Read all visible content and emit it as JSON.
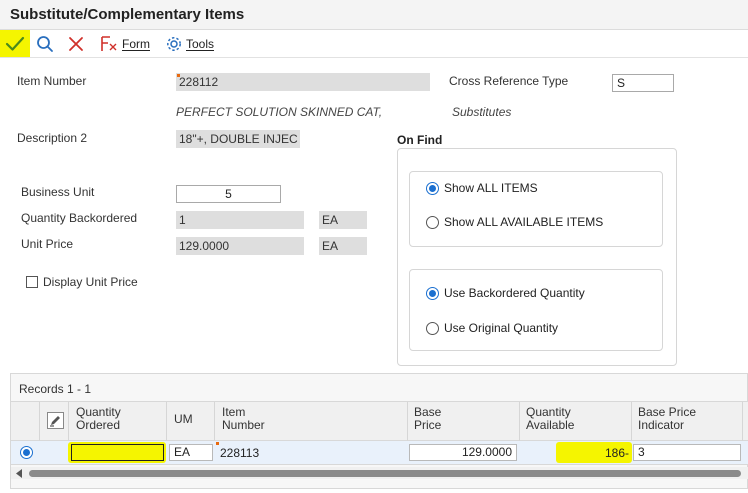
{
  "window": {
    "title": "Substitute/Complementary Items"
  },
  "toolbar": {
    "ok_icon": "checkmark-icon",
    "find_icon": "search-icon",
    "cancel_icon": "close-icon",
    "form_label": "Form",
    "tools_label": "Tools",
    "highlight_color": "#f5f500"
  },
  "header": {
    "item_number_label": "Item Number",
    "item_number_value": "228112",
    "item_description": "PERFECT SOLUTION SKINNED CAT,",
    "cross_ref_type_label": "Cross Reference Type",
    "cross_ref_type_value": "S",
    "cross_ref_type_desc": "Substitutes",
    "description2_label": "Description 2",
    "description2_value": "18\"+, DOUBLE INJEC",
    "business_unit_label": "Business Unit",
    "business_unit_value": "5",
    "qty_backordered_label": "Quantity Backordered",
    "qty_backordered_value": "1",
    "qty_backordered_um": "EA",
    "unit_price_label": "Unit Price",
    "unit_price_value": "129.0000",
    "unit_price_um": "EA",
    "display_unit_price_label": "Display Unit Price",
    "display_unit_price_checked": false
  },
  "on_find": {
    "title": "On Find",
    "show_all_items_label": "Show ALL ITEMS",
    "show_all_available_label": "Show ALL AVAILABLE ITEMS",
    "show_selected": "Show ALL ITEMS",
    "use_backordered_label": "Use Backordered Quantity",
    "use_original_label": "Use Original Quantity",
    "qty_selected": "Use Backordered Quantity"
  },
  "grid": {
    "records_label": "Records 1 - 1",
    "columns": {
      "quantity_ordered": "Quantity\nOrdered",
      "um": "UM",
      "item_number": "Item\nNumber",
      "base_price": "Base\nPrice",
      "quantity_available": "Quantity\nAvailable",
      "base_price_indicator": "Base Price\nIndicator"
    },
    "rows": [
      {
        "quantity_ordered": "",
        "um": "EA",
        "item_number": "228113",
        "base_price": "129.0000",
        "quantity_available": "186-",
        "base_price_indicator": "3"
      }
    ]
  }
}
